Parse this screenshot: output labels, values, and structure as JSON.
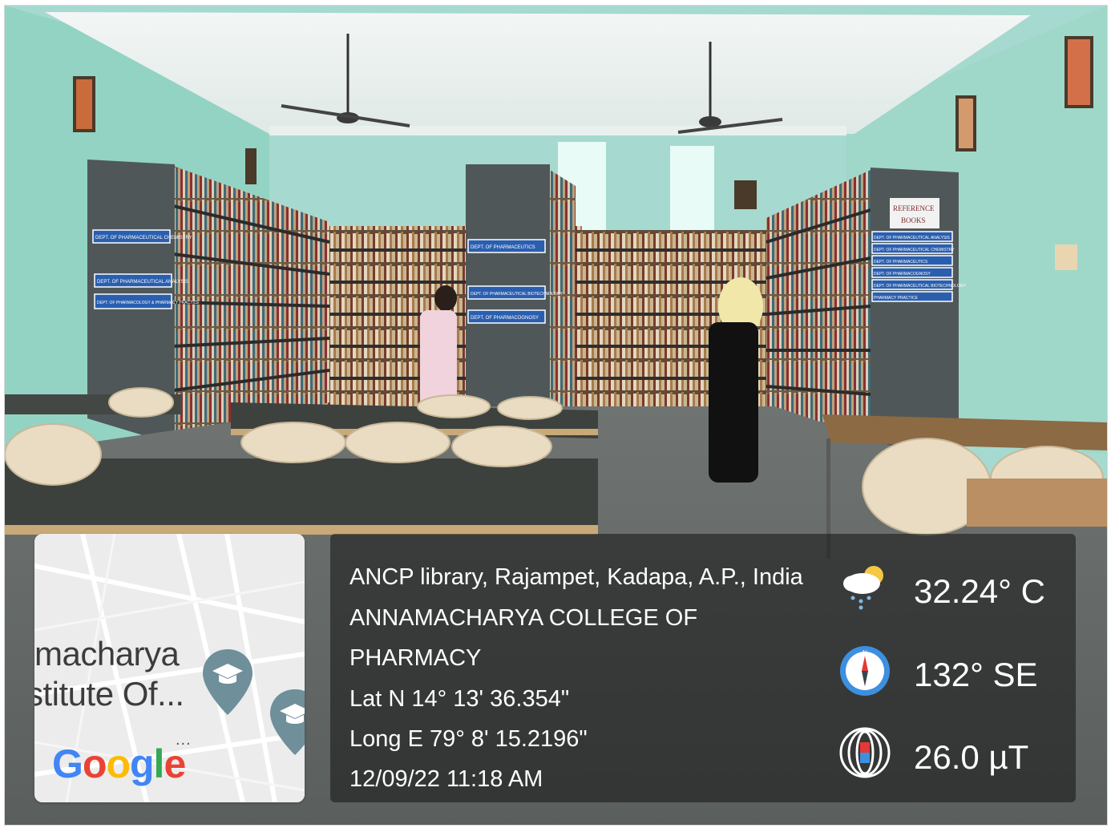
{
  "map": {
    "place_line1": "macharya",
    "place_line2": "stitute Of...",
    "more": "...",
    "logo": "Google",
    "pin_icon": "graduation-cap-pin-icon"
  },
  "info": {
    "location": "ANCP library, Rajampet, Kadapa, A.P., India",
    "college_line1": "ANNAMACHARYA COLLEGE OF",
    "college_line2": "PHARMACY",
    "latitude": "Lat N 14° 13' 36.354\"",
    "longitude": "Long E 79° 8' 15.2196\"",
    "datetime": "12/09/22 11:18 AM"
  },
  "readings": {
    "temperature": "32.24° C",
    "direction": "132° SE",
    "magnetic": "26.0 µT",
    "icons": [
      "weather-cloud-sun-icon",
      "compass-icon",
      "magnet-field-icon"
    ]
  },
  "signs": {
    "left_shelf": [
      "DEPT. OF PHARMACEUTICAL CHEMISTRY",
      "DEPT. OF PHARMACEUTICAL ANALYSIS",
      "DEPT. OF PHARMACOLOGY & PHARMACY PRACTICE"
    ],
    "middle_shelf": [
      "DEPT. OF PHARMACEUTICS",
      "DEPT. OF PHARMACEUTICAL BIOTECHNOLOGY",
      "DEPT. OF PHARMACOGNOSY"
    ],
    "right_shelf_title_1": "REFERENCE",
    "right_shelf_title_2": "BOOKS",
    "right_shelf": [
      "DEPT. OF PHARMACEUTICAL ANALYSIS",
      "DEPT. OF PHARMACEUTICAL CHEMISTRY",
      "DEPT. OF PHARMACEUTICS",
      "DEPT. OF PHARMACOGNOSY",
      "DEPT. OF PHARMACEUTICAL BIOTECHNOLOGY",
      "PHARMACY PRACTICE"
    ]
  }
}
